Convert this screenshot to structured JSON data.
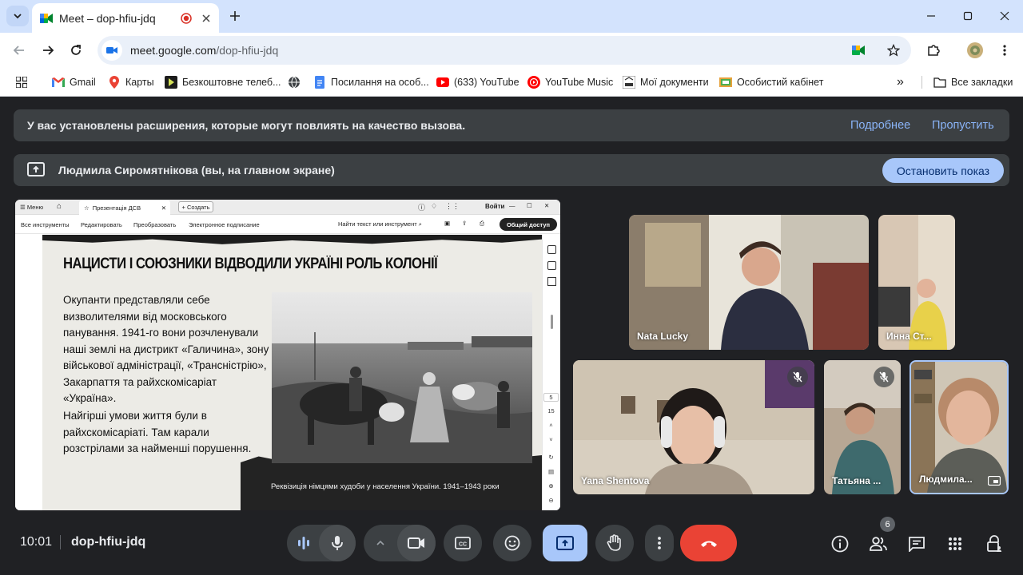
{
  "browser": {
    "tab_title": "Meet – dop-hfiu-jdq",
    "url_host": "meet.google.com",
    "url_path": "/dop-hfiu-jdq",
    "bookmarks": [
      {
        "label": "Gmail",
        "icon": "gmail-icon"
      },
      {
        "label": "Карты",
        "icon": "maps-icon"
      },
      {
        "label": "Безкоштовне телеб...",
        "icon": "tv-icon"
      },
      {
        "label": "",
        "icon": "globe-icon"
      },
      {
        "label": "Посилання на особ...",
        "icon": "docs-icon"
      },
      {
        "label": "(633) YouTube",
        "icon": "youtube-icon"
      },
      {
        "label": "YouTube Music",
        "icon": "youtube-music-icon"
      },
      {
        "label": "Мої документи",
        "icon": "eas-icon"
      },
      {
        "label": "Особистий кабінет",
        "icon": "cabinet-icon"
      }
    ],
    "all_bookmarks": "Все закладки",
    "more": "»"
  },
  "banner": {
    "text": "У вас установлены расширения, которые могут повлиять на качество вызова.",
    "more_link": "Подробнее",
    "skip_link": "Пропустить"
  },
  "presenting": {
    "text": "Людмила Сиромятнікова (вы, на главном экране)",
    "stop_button": "Остановить показ"
  },
  "shared_screen": {
    "menu": "Меню",
    "tab_title": "Презентація ДСВ",
    "create": "+ Создать",
    "login": "Войти",
    "tools": [
      "Все инструменты",
      "Редактировать",
      "Преобразовать",
      "Электронное подписание"
    ],
    "find": "Найти текст или инструмент",
    "share_button": "Общий доступ",
    "slide_title": "НАЦИСТИ І СОЮЗНИКИ ВІДВОДИЛИ УКРАЇНІ РОЛЬ КОЛОНІЇ",
    "slide_p1": "Окупанти представляли себе визволителями від московського панування. 1941-го вони розчленували наші землі на дистрикт «Галичина», зону військової адміністрації, «Трансністрію», Закарпаття та райхскомісаріат «Україна».",
    "slide_p2": "Найгірші умови життя були в райхскомісаріаті. Там карали розстрілами за найменші порушення.",
    "caption": "Реквізиція німцями худоби у населення України. 1941–1943 роки",
    "page_current": "5",
    "page_total": "15"
  },
  "participants": [
    {
      "name": "Nata Lucky",
      "muted": false
    },
    {
      "name": "Инна Ст...",
      "muted": false
    },
    {
      "name": "Yana Shentova",
      "muted": true
    },
    {
      "name": "Татьяна ...",
      "muted": true
    },
    {
      "name": "Людмила...",
      "muted": false
    }
  ],
  "controls": {
    "time": "10:01",
    "meeting_code": "dop-hfiu-jdq",
    "people_count": "6"
  },
  "colors": {
    "accent": "#a8c7fa",
    "end_call": "#ea4335",
    "present_active": "#a8c7fa",
    "link": "#8ab4f8"
  }
}
